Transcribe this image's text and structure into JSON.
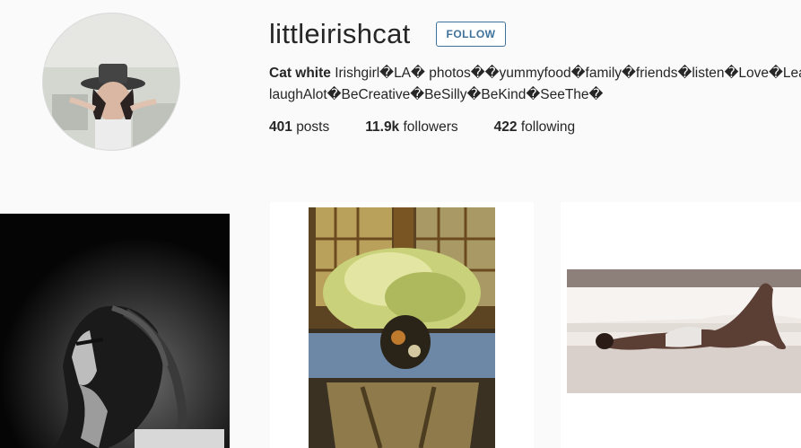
{
  "profile": {
    "username": "littleirishcat",
    "follow_label": "FOLLOW",
    "full_name": "Cat white",
    "bio_line1": "Irishgirl�LA� photos��yummyfood�family�friends�listen�Love�Learn�",
    "bio_line2": "laughAlot�BeCreative�BeSilly�BeKind�SeeThe�"
  },
  "stats": {
    "posts_count": "401",
    "posts_label": "posts",
    "followers_count": "11.9k",
    "followers_label": "followers",
    "following_count": "422",
    "following_label": "following"
  },
  "colors": {
    "accent": "#3f729b",
    "background": "#fafafa",
    "text": "#262626"
  }
}
